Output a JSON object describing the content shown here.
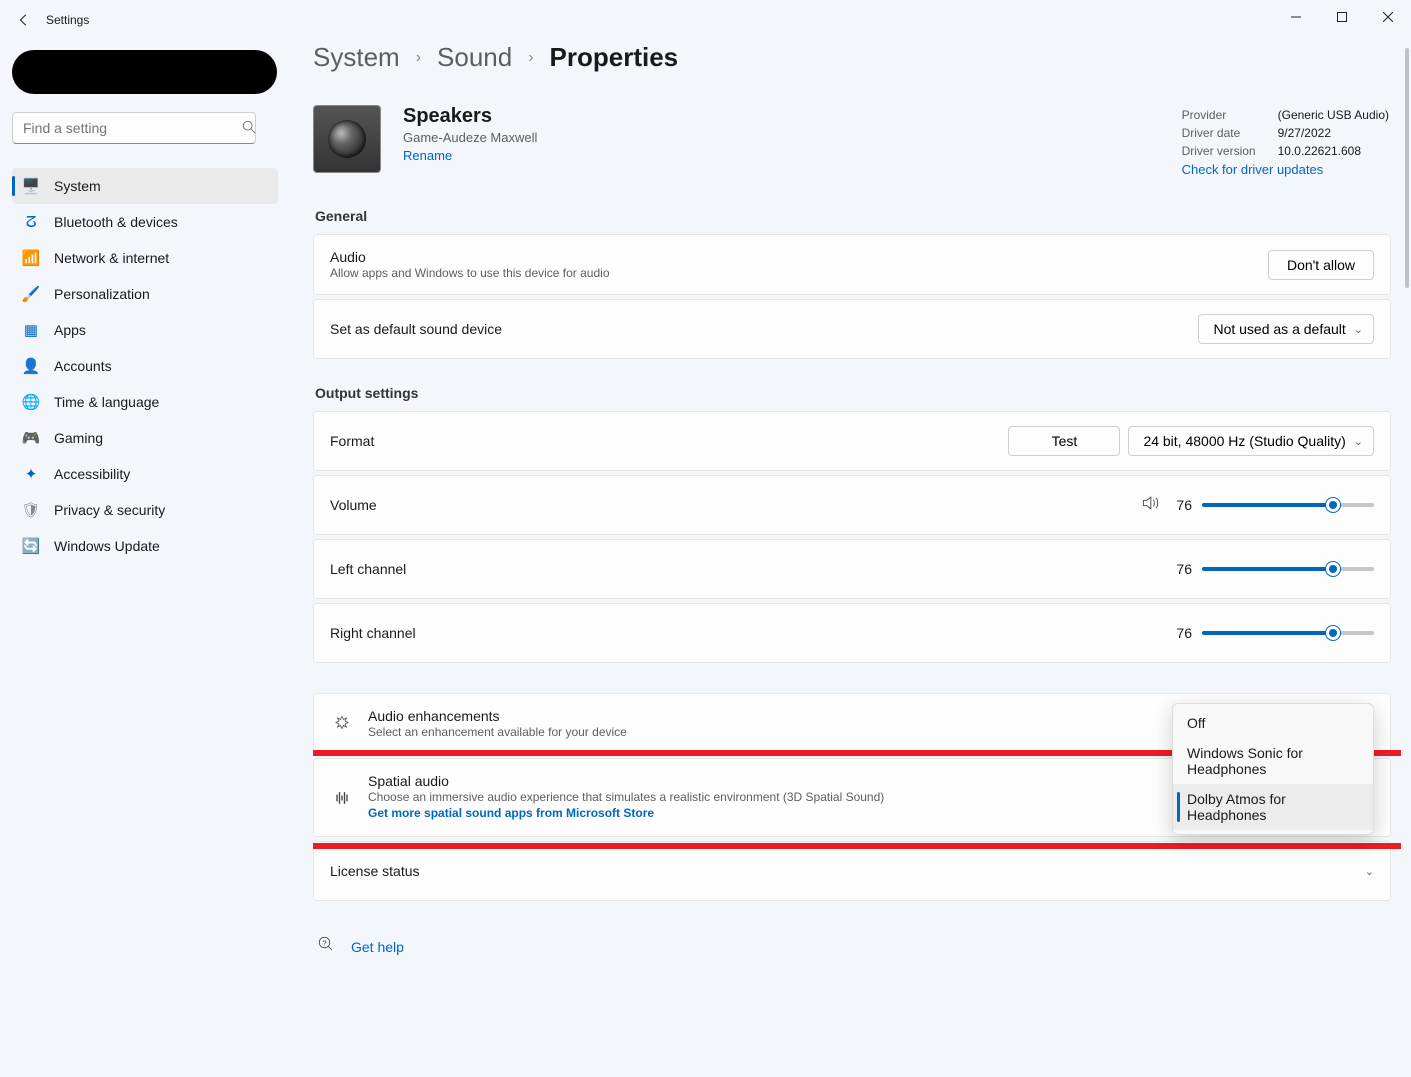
{
  "titlebar": {
    "title": "Settings"
  },
  "search": {
    "placeholder": "Find a setting"
  },
  "nav": [
    {
      "icon": "🖥️",
      "label": "System",
      "active": true,
      "color": "#0067c0"
    },
    {
      "icon": "ⵒ",
      "label": "Bluetooth & devices",
      "color": "#0067c0"
    },
    {
      "icon": "📶",
      "label": "Network & internet",
      "color": "#0067c0"
    },
    {
      "icon": "🖌️",
      "label": "Personalization",
      "color": "#666"
    },
    {
      "icon": "▦",
      "label": "Apps",
      "color": "#0067c0"
    },
    {
      "icon": "👤",
      "label": "Accounts",
      "color": "#0a8"
    },
    {
      "icon": "🌐",
      "label": "Time & language",
      "color": "#666"
    },
    {
      "icon": "🎮",
      "label": "Gaming",
      "color": "#888"
    },
    {
      "icon": "✦",
      "label": "Accessibility",
      "color": "#0067c0"
    },
    {
      "icon": "🛡",
      "label": "Privacy & security",
      "color": "#888"
    },
    {
      "icon": "🔄",
      "label": "Windows Update",
      "color": "#0067c0"
    }
  ],
  "breadcrumb": {
    "a": "System",
    "b": "Sound",
    "c": "Properties"
  },
  "device": {
    "name": "Speakers",
    "sub": "Game-Audeze Maxwell",
    "rename": "Rename"
  },
  "driver": {
    "provider_label": "Provider",
    "provider": "(Generic USB Audio)",
    "date_label": "Driver date",
    "date": "9/27/2022",
    "ver_label": "Driver version",
    "ver": "10.0.22621.608",
    "check": "Check for driver updates"
  },
  "sections": {
    "general": "General",
    "output": "Output settings"
  },
  "audio": {
    "title": "Audio",
    "sub": "Allow apps and Windows to use this device for audio",
    "btn": "Don't allow"
  },
  "default": {
    "title": "Set as default sound device",
    "value": "Not used as a default"
  },
  "format": {
    "title": "Format",
    "test": "Test",
    "value": "24 bit, 48000 Hz (Studio Quality)"
  },
  "volume": {
    "title": "Volume",
    "value": "76",
    "pct": 76
  },
  "left": {
    "title": "Left channel",
    "value": "76",
    "pct": 76
  },
  "right": {
    "title": "Right channel",
    "value": "76",
    "pct": 76
  },
  "enh": {
    "title": "Audio enhancements",
    "sub": "Select an enhancement available for your device"
  },
  "spatial": {
    "title": "Spatial audio",
    "sub": "Choose an immersive audio experience that simulates a realistic environment (3D Spatial Sound)",
    "link": "Get more spatial sound apps from Microsoft Store",
    "options": [
      "Off",
      "Windows Sonic for Headphones",
      "Dolby Atmos for Headphones"
    ],
    "selected": "Dolby Atmos for Headphones"
  },
  "license": {
    "title": "License status"
  },
  "help": {
    "label": "Get help"
  }
}
